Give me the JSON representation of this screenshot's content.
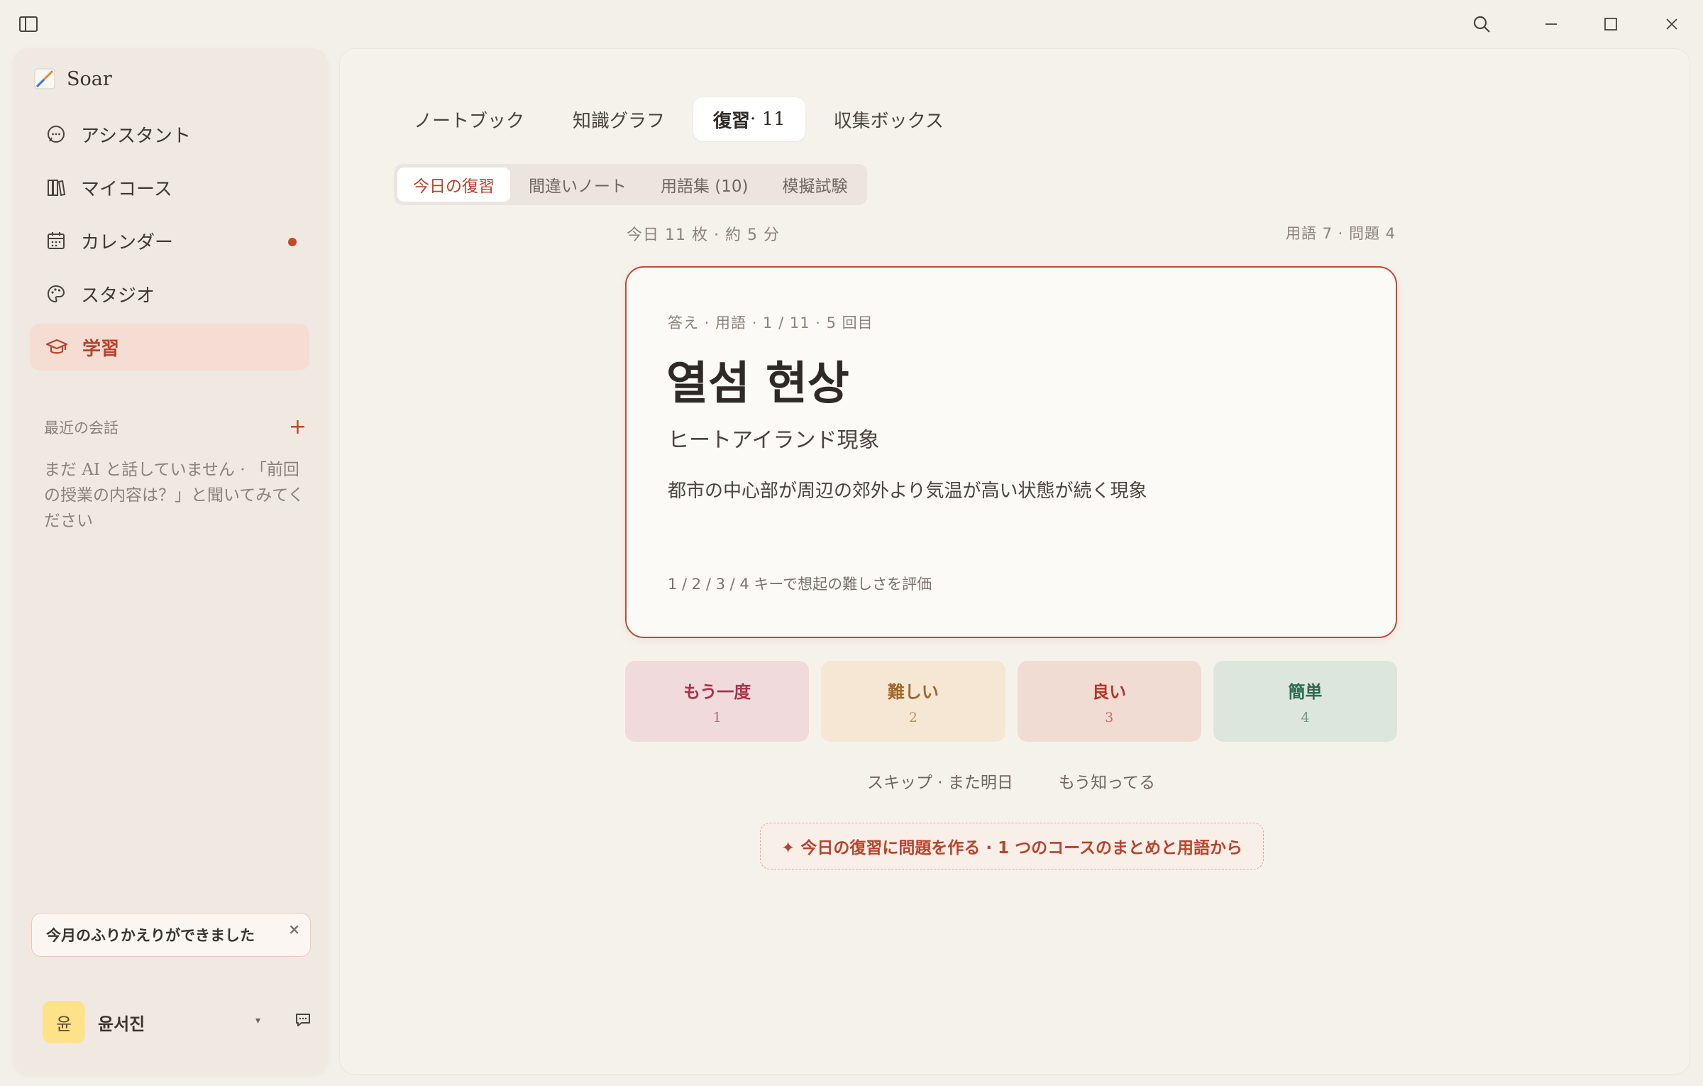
{
  "app": {
    "name": "Soar"
  },
  "sidebar": {
    "items": [
      {
        "label": "アシスタント",
        "icon": "chat-bubble-icon"
      },
      {
        "label": "マイコース",
        "icon": "books-icon"
      },
      {
        "label": "カレンダー",
        "icon": "calendar-icon",
        "badge_dot": true
      },
      {
        "label": "スタジオ",
        "icon": "palette-icon"
      },
      {
        "label": "学習",
        "icon": "graduation-cap-icon",
        "active": true
      }
    ],
    "recent_label": "最近の会話",
    "recent_add": "+",
    "recent_empty": "まだ AI と話していません · 「前回の授業の内容は？」と聞いてみてください",
    "toast": {
      "text": "今月のふりかえりができました",
      "close": "×"
    },
    "user": {
      "avatar": "윤",
      "name": "윤서진",
      "caret": "▾"
    }
  },
  "tabs": [
    {
      "label": "ノートブック"
    },
    {
      "label": "知識グラフ"
    },
    {
      "label": "復習",
      "suffix": " · 11",
      "active": true
    },
    {
      "label": "収集ボックス"
    }
  ],
  "subtabs": [
    {
      "label": "今日の復習",
      "active": true
    },
    {
      "label": "間違いノート"
    },
    {
      "label": "用語集 (10)"
    },
    {
      "label": "模擬試験"
    }
  ],
  "summary": {
    "left": "今日 11 枚 · 約 5 分",
    "right": "用語 7 · 問題 4"
  },
  "card": {
    "meta": "答え · 用語 · 1 / 11 · 5 回目",
    "term": "열섬 현상",
    "reading": "ヒートアイランド現象",
    "definition": "都市の中心部が周辺の郊外より気温が高い状態が続く現象",
    "hint": "1 / 2 / 3 / 4 キーで想起の難しさを評価"
  },
  "ratings": [
    {
      "label": "もう一度",
      "key": "1"
    },
    {
      "label": "難しい",
      "key": "2"
    },
    {
      "label": "良い",
      "key": "3"
    },
    {
      "label": "簡単",
      "key": "4"
    }
  ],
  "actions": {
    "skip": "スキップ · また明日",
    "known": "もう知ってる",
    "generate": "✦ 今日の復習に問題を作る · 1 つのコースのまとめと用語から"
  },
  "colors": {
    "accent": "#c24a2c",
    "background": "#f3efe9"
  }
}
